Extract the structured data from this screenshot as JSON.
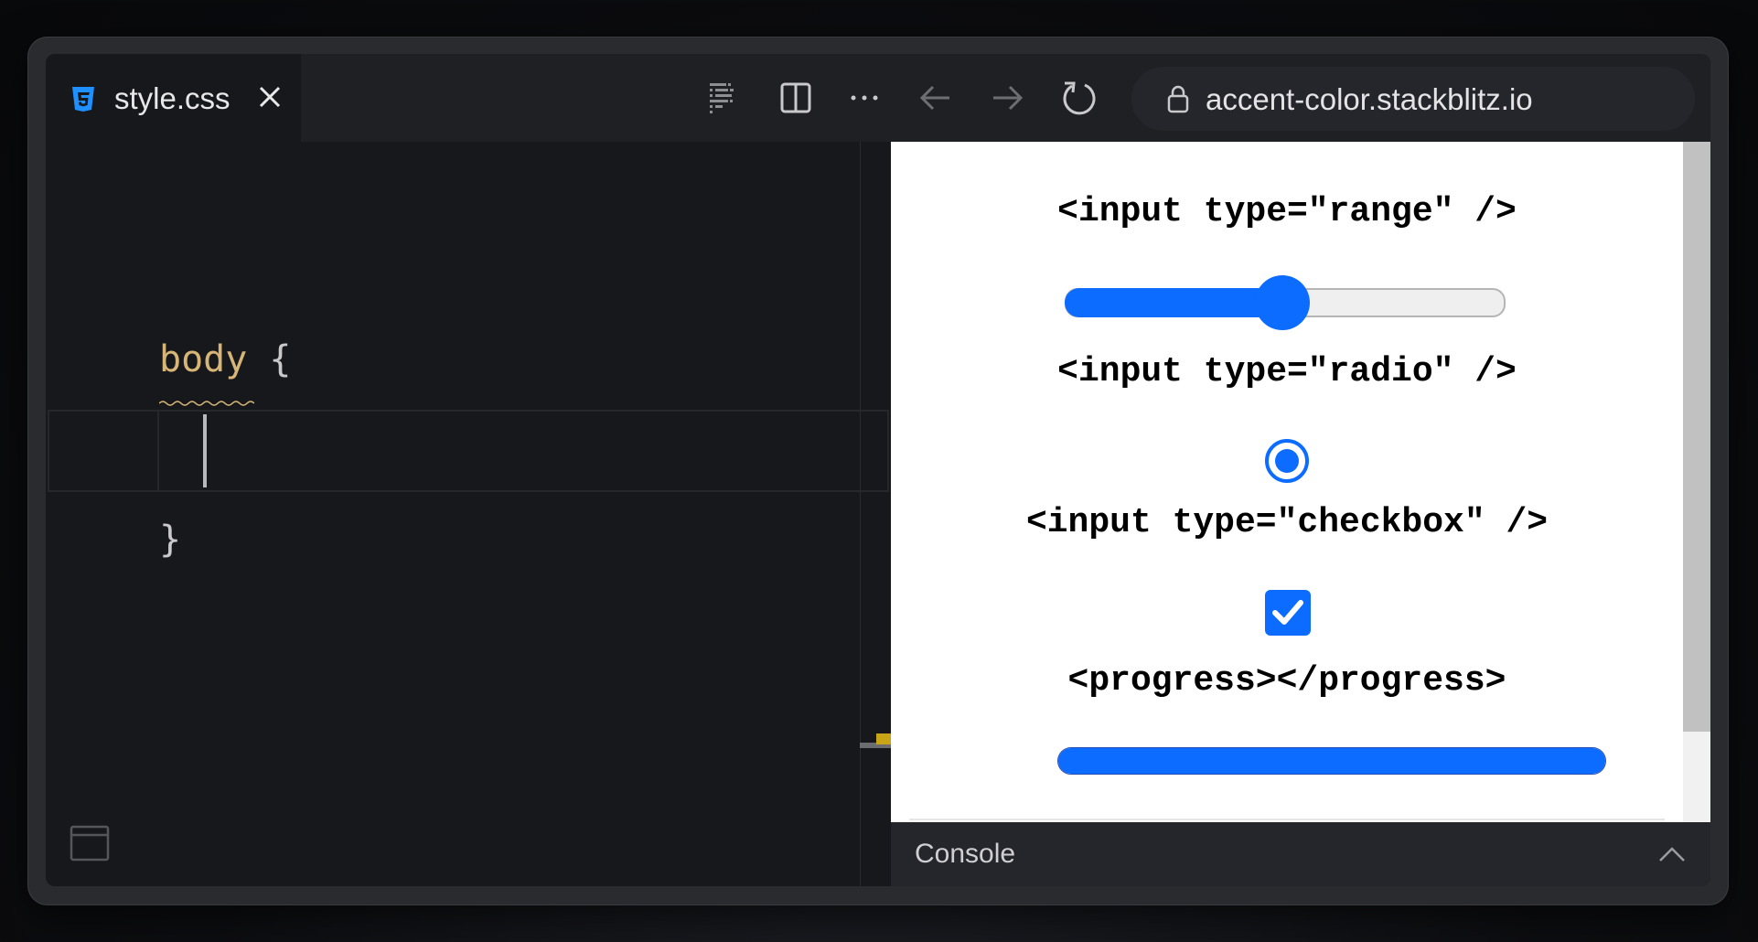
{
  "tab": {
    "filename": "style.css",
    "icon": "css3-icon"
  },
  "toolbar": {
    "icons": [
      "prettier-icon",
      "split-view-icon",
      "more-icon",
      "back-arrow-icon",
      "forward-arrow-icon",
      "reload-icon"
    ]
  },
  "address_bar": {
    "url": "accent-color.stackblitz.io",
    "icon": "lock-icon"
  },
  "editor": {
    "selector": "body",
    "open_brace": "{",
    "close_brace": "}"
  },
  "preview": {
    "range_label": "<input type=\"range\" />",
    "range_value_percent": 50,
    "radio_label": "<input type=\"radio\" />",
    "radio_checked": true,
    "checkbox_label": "<input type=\"checkbox\" />",
    "checkbox_checked": true,
    "progress_label": "<progress></progress>",
    "progress_value_percent": 100
  },
  "console": {
    "label": "Console"
  },
  "colors": {
    "accent": "#0b6cff",
    "editor_bg": "#17181c",
    "selector": "#d6b577"
  }
}
